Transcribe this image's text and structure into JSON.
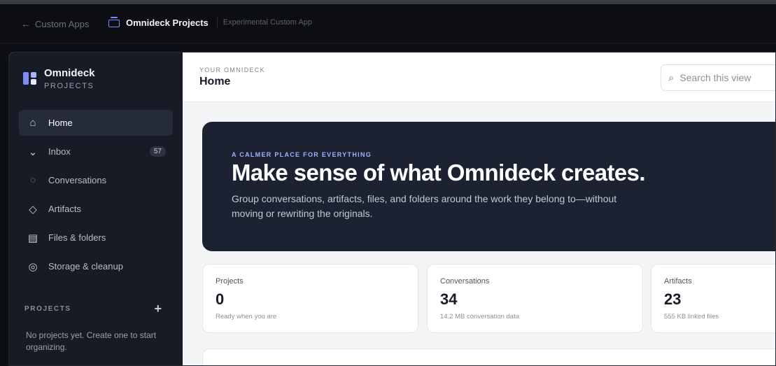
{
  "topbar": {
    "back_label": "Custom Apps",
    "app_title": "Omnideck Projects",
    "app_subtitle": "Experimental Custom App"
  },
  "sidebar": {
    "brand_name": "Omnideck",
    "brand_sub": "PROJECTS",
    "items": [
      {
        "label": "Home",
        "icon": "home-icon"
      },
      {
        "label": "Inbox",
        "icon": "chevron-down-icon",
        "badge": "57"
      },
      {
        "label": "Conversations",
        "icon": "circle-icon"
      },
      {
        "label": "Artifacts",
        "icon": "diamond-icon"
      },
      {
        "label": "Files & folders",
        "icon": "files-icon"
      },
      {
        "label": "Storage & cleanup",
        "icon": "target-icon"
      }
    ],
    "projects_label": "PROJECTS",
    "projects_empty": "No projects yet. Create one to start organizing."
  },
  "header": {
    "eyebrow": "YOUR OMNIDECK",
    "title": "Home",
    "search_placeholder": "Search this view"
  },
  "hero": {
    "eyebrow": "A CALMER PLACE FOR EVERYTHING",
    "title": "Make sense of what Omnideck creates.",
    "description": "Group conversations, artifacts, files, and folders around the work they belong to—without moving or rewriting the originals."
  },
  "stats": [
    {
      "label": "Projects",
      "value": "0",
      "sub": "Ready when you are"
    },
    {
      "label": "Conversations",
      "value": "34",
      "sub": "14.2 MB conversation data"
    },
    {
      "label": "Artifacts",
      "value": "23",
      "sub": "555 KB linked files"
    }
  ],
  "colors": {
    "accent": "#6d8dff",
    "sidebar_bg": "#161b26",
    "hero_bg": "#1c2231"
  }
}
